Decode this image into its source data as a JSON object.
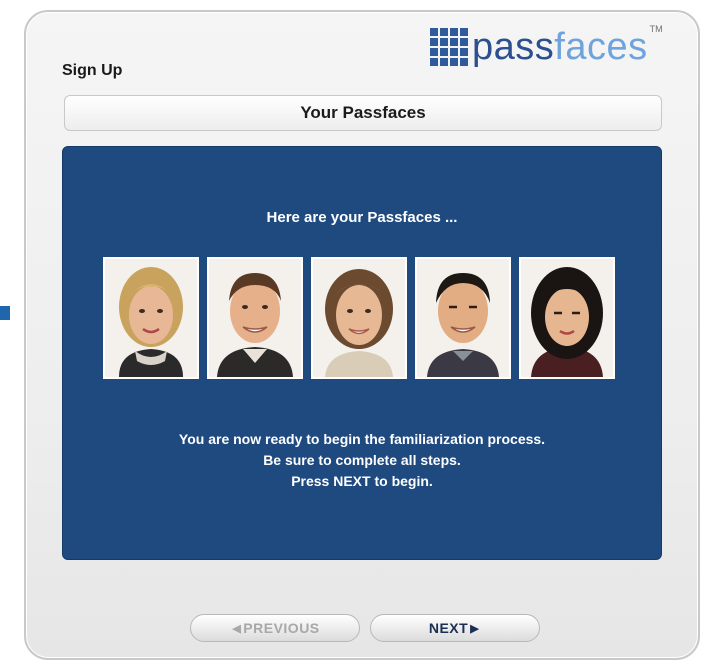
{
  "header": {
    "signup_label": "Sign Up",
    "logo_pass": "pass",
    "logo_faces": "faces",
    "logo_tm": "TM"
  },
  "title": "Your Passfaces",
  "content": {
    "heading": "Here are your Passfaces ...",
    "faces": [
      {
        "name": "face-1-blonde-woman"
      },
      {
        "name": "face-2-man-brown-hair"
      },
      {
        "name": "face-3-woman-brown-hair"
      },
      {
        "name": "face-4-asian-man"
      },
      {
        "name": "face-5-asian-woman"
      }
    ],
    "line1": "You are now ready to begin the familiarization process.",
    "line2": "Be sure to complete all steps.",
    "line3": "Press NEXT to begin."
  },
  "buttons": {
    "previous": "PREVIOUS",
    "next": "NEXT"
  },
  "colors": {
    "content_background": "#1f4a80",
    "logo_dark": "#2b4f8f",
    "logo_light": "#6fa3dc"
  }
}
